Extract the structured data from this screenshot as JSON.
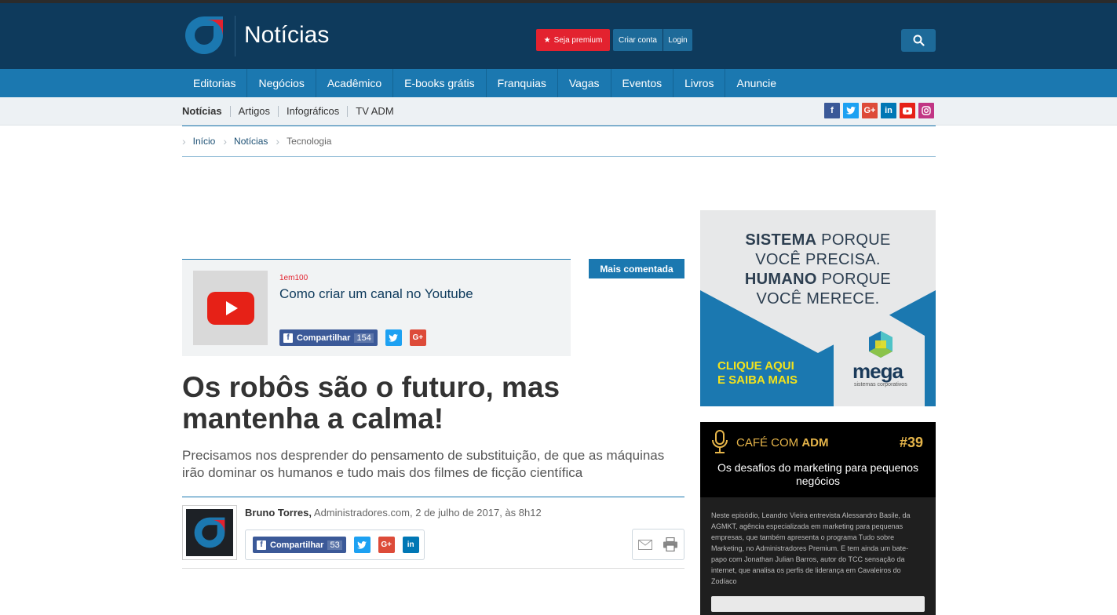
{
  "header": {
    "brand_title": "Notícias",
    "premium_label": "Seja premium",
    "create_account_label": "Criar conta",
    "login_label": "Login"
  },
  "main_nav": [
    "Editorias",
    "Negócios",
    "Acadêmico",
    "E-books grátis",
    "Franquias",
    "Vagas",
    "Eventos",
    "Livros",
    "Anuncie"
  ],
  "sub_nav": [
    "Notícias",
    "Artigos",
    "Infográficos",
    "TV ADM"
  ],
  "social_icons": [
    "facebook-icon",
    "twitter-icon",
    "google-plus-icon",
    "linkedin-icon",
    "youtube-icon",
    "instagram-icon"
  ],
  "breadcrumb": [
    "Início",
    "Notícias",
    "Tecnologia"
  ],
  "most_commented": {
    "tag": "Mais comentada",
    "category": "1em100",
    "title": "Como criar um canal no Youtube",
    "share_label": "Compartilhar",
    "share_count": "154"
  },
  "article": {
    "title": "Os robôs são o futuro, mas mantenha a calma!",
    "subtitle": "Precisamos nos desprender do pensamento de substituição, de que as máquinas irão dominar os humanos e tudo mais dos filmes de ficção científica",
    "author": "Bruno Torres,",
    "source_date": "Administradores.com, 2 de julho de 2017, às 8h12",
    "share_label": "Compartilhar",
    "share_count": "53"
  },
  "ad": {
    "line1_bold": "SISTEMA",
    "line1_rest": " PORQUE",
    "line2": "VOCÊ PRECISA.",
    "line3_bold": "HUMANO",
    "line3_rest": " PORQUE",
    "line4": "VOCÊ MERECE.",
    "cta_line1": "CLIQUE AQUI",
    "cta_line2": "E SAIBA MAIS",
    "brand": "mega",
    "brand_sub": "sistemas corporativos"
  },
  "podcast": {
    "label_prefix": "CAFÉ COM ",
    "label_bold": "ADM",
    "episode": "#39",
    "title": "Os desafios do marketing para pequenos negócios",
    "description": "Neste episódio, Leandro Vieira entrevista Alessandro Basile, da AGMKT, agência especializada em marketing para pequenas empresas, que também apresenta o programa Tudo sobre Marketing, no Administradores Premium. E tem ainda um bate-papo com Jonathan Julian Barros, autor do TCC sensação da internet, que analisa os perfis de liderança em Cavaleiros do Zodíaco"
  },
  "colors": {
    "header_bg": "#0e3a5c",
    "nav_bg": "#1b78b0",
    "premium_red": "#e3222f",
    "facebook": "#3b5998",
    "twitter": "#1da1f2",
    "google_plus": "#dd4b39",
    "linkedin": "#0077b5",
    "youtube": "#e62117",
    "instagram": "#c13584",
    "podcast_gold": "#e6b54a"
  }
}
